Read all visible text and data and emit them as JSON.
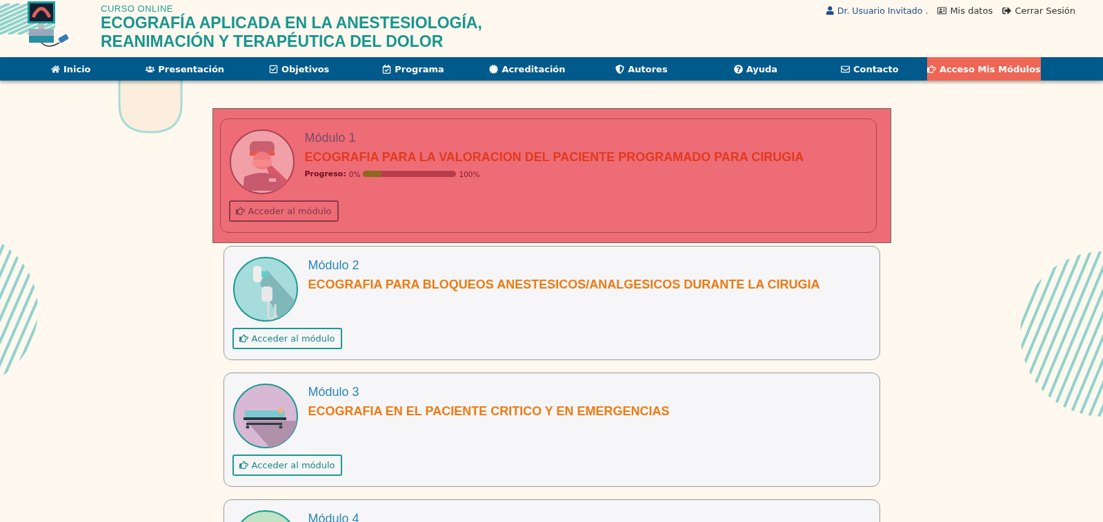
{
  "header": {
    "kicker": "CURSO ONLINE",
    "title_lines": [
      "ECOGRAFÍA APLICADA EN LA ANESTESIOLOGÍA,",
      "REANIMACIÓN Y TERAPÉUTICA DEL DOLOR"
    ],
    "user": "Dr. Usuario Invitado .",
    "links": [
      {
        "kind": "profile",
        "label": "Mis datos"
      },
      {
        "kind": "logout",
        "label": "Cerrar Sesión"
      }
    ]
  },
  "nav": [
    {
      "label": "Inicio",
      "selected": false
    },
    {
      "label": "Presentación",
      "selected": false
    },
    {
      "label": "Objetivos",
      "selected": false
    },
    {
      "label": "Programa",
      "selected": false
    },
    {
      "label": "Acreditación",
      "selected": false
    },
    {
      "label": "Autores",
      "selected": false
    },
    {
      "label": "Ayuda",
      "selected": false
    },
    {
      "label": "Contacto",
      "selected": false
    },
    {
      "label": "Acceso Mis Módulos",
      "selected": true
    }
  ],
  "modules": [
    {
      "kind": "surgeon",
      "color": "#f2a0a8",
      "highlighted": true,
      "label": "Módulo 1",
      "title": "ECOGRAFIA PARA LA VALORACION DEL PACIENTE PROGRAMADO PARA CIRUGIA",
      "progress": {
        "label": "Progreso:",
        "min": "0%",
        "max": "100%",
        "level": 0.2
      },
      "button": "Acceder al módulo"
    },
    {
      "kind": "mask",
      "color": "#a6dcdc",
      "highlighted": false,
      "label": "Módulo 2",
      "title": "ECOGRAFIA PARA BLOQUEOS ANESTESICOS/ANALGESICOS DURANTE LA CIRUGIA",
      "button": "Acceder al módulo"
    },
    {
      "kind": "stretcher",
      "color": "#d8b8d4",
      "highlighted": false,
      "label": "Módulo 3",
      "title": "ECOGRAFIA EN EL PACIENTE CRITICO Y EN EMERGENCIAS",
      "button": "Acceder al módulo"
    },
    {
      "kind": "other",
      "color": "#bfe3c4",
      "highlighted": false,
      "label": "Módulo 4"
    }
  ]
}
